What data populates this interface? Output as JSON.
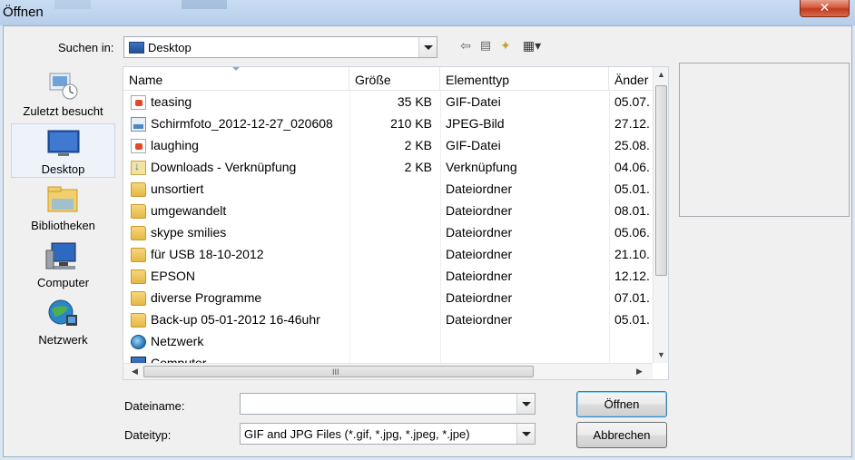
{
  "window": {
    "title": "Öffnen",
    "close_glyph": "✕"
  },
  "look_in": {
    "label": "Suchen in:",
    "value": "Desktop"
  },
  "places": [
    {
      "label": "Zuletzt besucht",
      "icon": "recent-places-icon"
    },
    {
      "label": "Desktop",
      "icon": "desktop-icon"
    },
    {
      "label": "Bibliotheken",
      "icon": "libraries-icon"
    },
    {
      "label": "Computer",
      "icon": "computer-icon"
    },
    {
      "label": "Netzwerk",
      "icon": "network-icon"
    }
  ],
  "columns": {
    "name": "Name",
    "size": "Größe",
    "type": "Elementtyp",
    "date": "Änder"
  },
  "files": [
    {
      "name": "teasing",
      "size": "35 KB",
      "type": "GIF-Datei",
      "date": "05.07.",
      "icon": "gif"
    },
    {
      "name": "Schirmfoto_2012-12-27_020608",
      "size": "210 KB",
      "type": "JPEG-Bild",
      "date": "27.12.",
      "icon": "jpg"
    },
    {
      "name": "laughing",
      "size": "2 KB",
      "type": "GIF-Datei",
      "date": "25.08.",
      "icon": "gif"
    },
    {
      "name": "Downloads - Verknüpfung",
      "size": "2 KB",
      "type": "Verknüpfung",
      "date": "04.06.",
      "icon": "shortcut"
    },
    {
      "name": "unsortiert",
      "size": "",
      "type": "Dateiordner",
      "date": "05.01.",
      "icon": "folder"
    },
    {
      "name": "umgewandelt",
      "size": "",
      "type": "Dateiordner",
      "date": "08.01.",
      "icon": "folder"
    },
    {
      "name": "skype smilies",
      "size": "",
      "type": "Dateiordner",
      "date": "05.06.",
      "icon": "folder"
    },
    {
      "name": "für USB 18-10-2012",
      "size": "",
      "type": "Dateiordner",
      "date": "21.10.",
      "icon": "folder"
    },
    {
      "name": "EPSON",
      "size": "",
      "type": "Dateiordner",
      "date": "12.12.",
      "icon": "folder"
    },
    {
      "name": "diverse Programme",
      "size": "",
      "type": "Dateiordner",
      "date": "07.01.",
      "icon": "folder"
    },
    {
      "name": "Back-up 05-01-2012 16-46uhr",
      "size": "",
      "type": "Dateiordner",
      "date": "05.01.",
      "icon": "folder"
    },
    {
      "name": "Netzwerk",
      "size": "",
      "type": "",
      "date": "",
      "icon": "network"
    },
    {
      "name": "Computer",
      "size": "",
      "type": "",
      "date": "",
      "icon": "computer"
    }
  ],
  "filename": {
    "label": "Dateiname:",
    "value": ""
  },
  "filetype": {
    "label": "Dateityp:",
    "value": "GIF and JPG Files (*.gif, *.jpg, *.jpeg, *.jpe)"
  },
  "buttons": {
    "open": "Öffnen",
    "cancel": "Abbrechen"
  },
  "scroll": {
    "grip": "III",
    "up": "▲",
    "down": "▼",
    "left": "◀",
    "right": "▶"
  }
}
